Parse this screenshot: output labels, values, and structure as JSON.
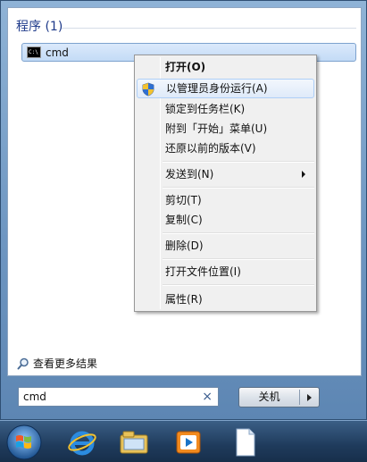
{
  "start_menu": {
    "section_header": "程序 (1)",
    "result": {
      "label": "cmd",
      "icon": "cmd-icon"
    },
    "see_more_label": "查看更多结果",
    "search": {
      "value": "cmd",
      "clear_glyph": "×"
    },
    "shutdown": {
      "label": "关机"
    }
  },
  "context_menu": {
    "items": [
      {
        "label": "打开(O)",
        "bold": true
      },
      {
        "label": "以管理员身份运行(A)",
        "icon": "uac-shield-icon",
        "highlighted": true
      },
      {
        "label": "锁定到任务栏(K)"
      },
      {
        "label": "附到「开始」菜单(U)"
      },
      {
        "label": "还原以前的版本(V)"
      },
      {
        "label": "发送到(N)",
        "submenu": true
      },
      {
        "label": "剪切(T)"
      },
      {
        "label": "复制(C)"
      },
      {
        "label": "删除(D)"
      },
      {
        "label": "打开文件位置(I)"
      },
      {
        "label": "属性(R)"
      }
    ]
  },
  "taskbar": {
    "items": [
      "start-orb-icon",
      "internet-explorer-icon",
      "file-explorer-icon",
      "media-player-icon",
      "document-icon"
    ]
  },
  "colors": {
    "section_header": "#1e3a8a",
    "menu_highlight_border": "#aecff7",
    "taskbar": "#1f3b5c"
  }
}
